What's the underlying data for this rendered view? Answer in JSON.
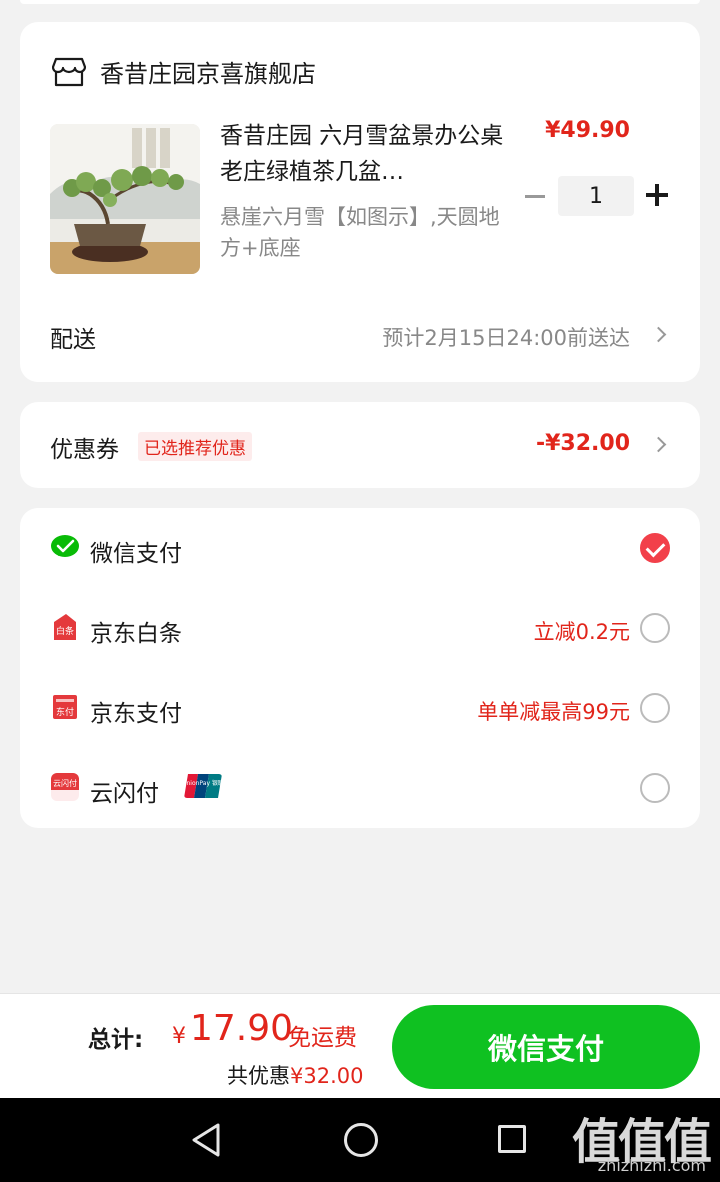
{
  "store": {
    "name": "香昔庄园京喜旗舰店",
    "product": {
      "title": "香昔庄园 六月雪盆景办公桌老庄绿植茶几盆…",
      "spec": "悬崖六月雪【如图示】,天圆地方+底座",
      "price": "¥49.90",
      "quantity": "1"
    },
    "delivery": {
      "label": "配送",
      "value": "预计2月15日24:00前送达"
    }
  },
  "coupon": {
    "label": "优惠券",
    "tag": "已选推荐优惠",
    "amount": "-¥32.00"
  },
  "payment_methods": [
    {
      "label": "微信支付",
      "promo": "",
      "selected": true,
      "icon": "wechat-pay-icon"
    },
    {
      "label": "京东白条",
      "promo": "立减0.2元",
      "selected": false,
      "icon": "jd-baitiao-icon"
    },
    {
      "label": "京东支付",
      "promo": "单单减最高99元",
      "selected": false,
      "icon": "jd-pay-icon"
    },
    {
      "label": "云闪付",
      "promo": "",
      "selected": false,
      "icon": "quickpass-icon"
    }
  ],
  "unionpay_logo_text": "UnionPay 银联",
  "icon_labels": {
    "baitiao": "白条",
    "jdpay": "东付",
    "quickpass": "云闪付"
  },
  "bottom_bar": {
    "total_label": "总计:",
    "currency": "¥",
    "total_amount": "17.90",
    "free_shipping": "免运费",
    "saved_label": "共优惠",
    "saved_amount": "¥32.00",
    "pay_button": "微信支付"
  },
  "watermark": {
    "logo": "值值值",
    "url": "zhizhizhi.com"
  },
  "colors": {
    "accent_red": "#e1251b",
    "pay_green": "#0fc121",
    "background": "#f2f2f2"
  }
}
